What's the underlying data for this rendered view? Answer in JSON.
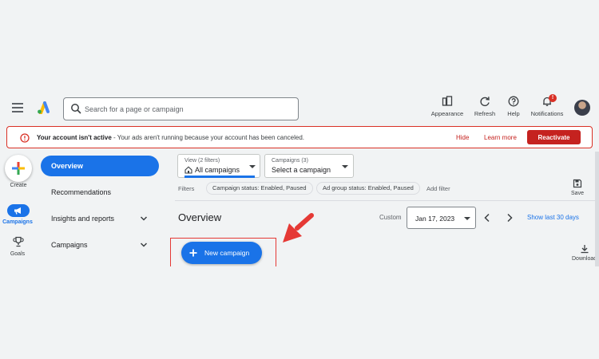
{
  "search": {
    "placeholder": "Search for a page or campaign"
  },
  "toolbar": {
    "appearance_label": "Appearance",
    "refresh_label": "Refresh",
    "help_label": "Help",
    "notifications_label": "Notifications",
    "notifications_badge": "!"
  },
  "alert": {
    "title": "Your account isn't active",
    "message": " - Your ads aren't running because your account has been canceled.",
    "hide_label": "Hide",
    "learn_more_label": "Learn more",
    "reactivate_label": "Reactivate"
  },
  "rail": {
    "create_label": "Create",
    "campaigns_label": "Campaigns",
    "goals_label": "Goals"
  },
  "nav": {
    "items": [
      {
        "label": "Overview",
        "active": true
      },
      {
        "label": "Recommendations",
        "active": false
      },
      {
        "label": "Insights and reports",
        "active": false
      },
      {
        "label": "Campaigns",
        "active": false
      }
    ]
  },
  "view_filter": {
    "caption": "View (2 filters)",
    "value": "All campaigns"
  },
  "campaigns_filter": {
    "caption": "Campaigns (3)",
    "value": "Select a campaign"
  },
  "filters": {
    "label": "Filters",
    "chips": [
      "Campaign status: Enabled, Paused",
      "Ad group status: Enabled, Paused"
    ],
    "add_label": "Add filter",
    "save_label": "Save"
  },
  "overview": {
    "title": "Overview",
    "custom_label": "Custom",
    "date": "Jan 17, 2023",
    "last_30_label": "Show last 30 days",
    "new_campaign_label": "New campaign",
    "download_label": "Download"
  },
  "colors": {
    "primary": "#1a73e8",
    "alert_red": "#c5221f",
    "annotation_red": "#e53935"
  }
}
